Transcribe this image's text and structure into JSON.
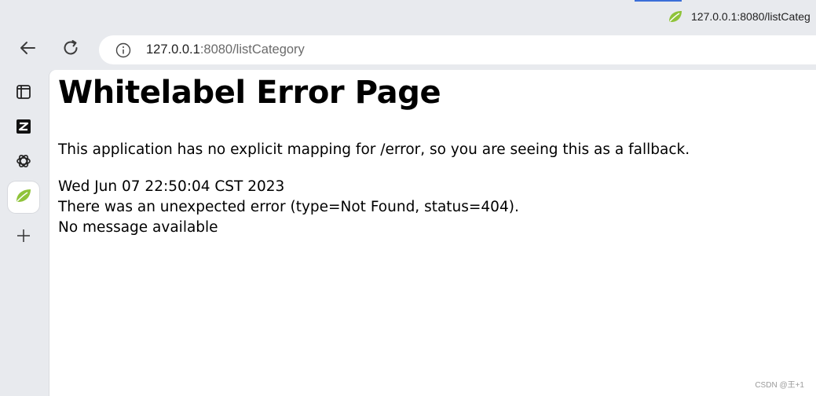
{
  "tab": {
    "title": "127.0.0.1:8080/listCateg",
    "favicon": "spring-leaf-icon"
  },
  "toolbar": {
    "back_icon": "back-arrow-icon",
    "reload_icon": "reload-icon",
    "info_icon": "site-info-icon",
    "url_host": "127.0.0.1",
    "url_rest": ":8080/listCategory"
  },
  "sidebar": {
    "items": [
      {
        "name": "sidebar-panel-toggle",
        "icon": "panel-icon"
      },
      {
        "name": "sidebar-app-z",
        "icon": "z-app-icon"
      },
      {
        "name": "sidebar-app-openai",
        "icon": "openai-icon"
      },
      {
        "name": "sidebar-app-spring",
        "icon": "spring-leaf-icon",
        "active": true
      },
      {
        "name": "sidebar-add",
        "icon": "plus-icon"
      }
    ]
  },
  "page": {
    "title": "Whitelabel Error Page",
    "explanation": "This application has no explicit mapping for /error, so you are seeing this as a fallback.",
    "timestamp": "Wed Jun 07 22:50:04 CST 2023",
    "error_line": "There was an unexpected error (type=Not Found, status=404).",
    "message": "No message available"
  },
  "watermark": "CSDN @王+1",
  "colors": {
    "chrome_bg": "#e8eaee",
    "spring_green": "#6db33f",
    "text": "#000000"
  }
}
